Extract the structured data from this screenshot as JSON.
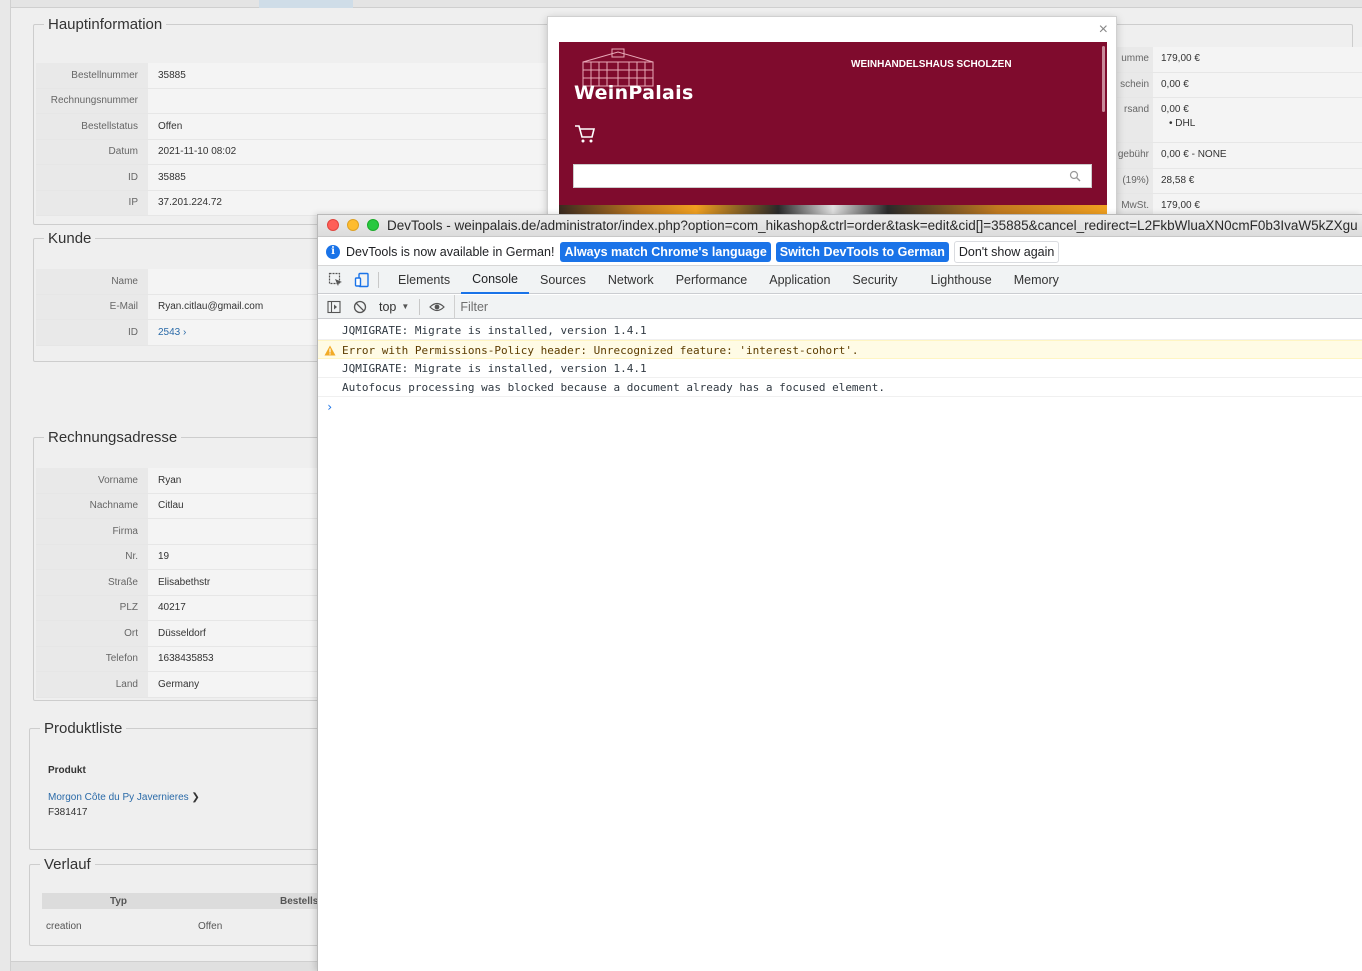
{
  "admin": {
    "haupt": {
      "legend": "Hauptinformation",
      "rows": [
        {
          "k": "Bestellnummer",
          "v": "35885"
        },
        {
          "k": "Rechnungsnummer",
          "v": ""
        },
        {
          "k": "Bestellstatus",
          "v": "Offen"
        },
        {
          "k": "Datum",
          "v": "2021-11-10 08:02"
        },
        {
          "k": "ID",
          "v": "35885"
        },
        {
          "k": "IP",
          "v": "37.201.224.72"
        }
      ]
    },
    "summary": [
      {
        "k": "umme",
        "v": "179,00 €",
        "sub": ""
      },
      {
        "k": "schein",
        "v": "0,00 €",
        "sub": ""
      },
      {
        "k": "rsand",
        "v": "0,00 €",
        "sub": "• DHL"
      },
      {
        "k": "gebühr",
        "v": "0,00 € - NONE",
        "sub": ""
      },
      {
        "k": "(19%)",
        "v": "28,58 €",
        "sub": ""
      },
      {
        "k": "MwSt.",
        "v": "179,00 €",
        "sub": ""
      }
    ],
    "kunde": {
      "legend": "Kunde",
      "rows": [
        {
          "k": "Name",
          "v": ""
        },
        {
          "k": "E-Mail",
          "v": "Ryan.citlau@gmail.com"
        },
        {
          "k": "ID",
          "v": "2543 ›"
        }
      ]
    },
    "rechnung": {
      "legend": "Rechnungsadresse",
      "rows": [
        {
          "k": "Vorname",
          "v": "Ryan"
        },
        {
          "k": "Nachname",
          "v": "Citlau"
        },
        {
          "k": "Firma",
          "v": ""
        },
        {
          "k": "Nr.",
          "v": "19"
        },
        {
          "k": "Straße",
          "v": "Elisabethstr"
        },
        {
          "k": "PLZ",
          "v": "40217"
        },
        {
          "k": "Ort",
          "v": "Düsseldorf"
        },
        {
          "k": "Telefon",
          "v": "1638435853"
        },
        {
          "k": "Land",
          "v": "Germany"
        }
      ]
    },
    "produkt": {
      "legend": "Produktliste",
      "header": "Produkt",
      "item_name": "Morgon Côte du Py Javernieres",
      "item_sku": "F381417"
    },
    "verlauf": {
      "legend": "Verlauf",
      "col_typ": "Typ",
      "col_status": "Bestellst",
      "row_typ": "creation",
      "row_status": "Offen"
    }
  },
  "modal": {
    "close": "×",
    "site_logo": "WeinPalais",
    "site_name": "WEINHANDELSHAUS SCHOLZEN"
  },
  "devtools": {
    "title": "DevTools - weinpalais.de/administrator/index.php?option=com_hikashop&ctrl=order&task=edit&cid[]=35885&cancel_redirect=L2FkbWluaXN0cmF0b3IvaW5kZXgu",
    "infobar": {
      "text": "DevTools is now available in German!",
      "btn_match": "Always match Chrome's language",
      "btn_switch": "Switch DevTools to German",
      "btn_dismiss": "Don't show again"
    },
    "tabs": [
      "Elements",
      "Console",
      "Sources",
      "Network",
      "Performance",
      "Application",
      "Security",
      "Lighthouse",
      "Memory"
    ],
    "context": "top",
    "filter_placeholder": "Filter",
    "logs": [
      {
        "type": "info",
        "text": "JQMIGRATE: Migrate is installed, version 1.4.1"
      },
      {
        "type": "warn",
        "text": "Error with Permissions-Policy header: Unrecognized feature: 'interest-cohort'."
      },
      {
        "type": "info",
        "text": "JQMIGRATE: Migrate is installed, version 1.4.1"
      },
      {
        "type": "info",
        "text": "Autofocus processing was blocked because a document already has a focused element."
      }
    ],
    "prompt": "›"
  }
}
